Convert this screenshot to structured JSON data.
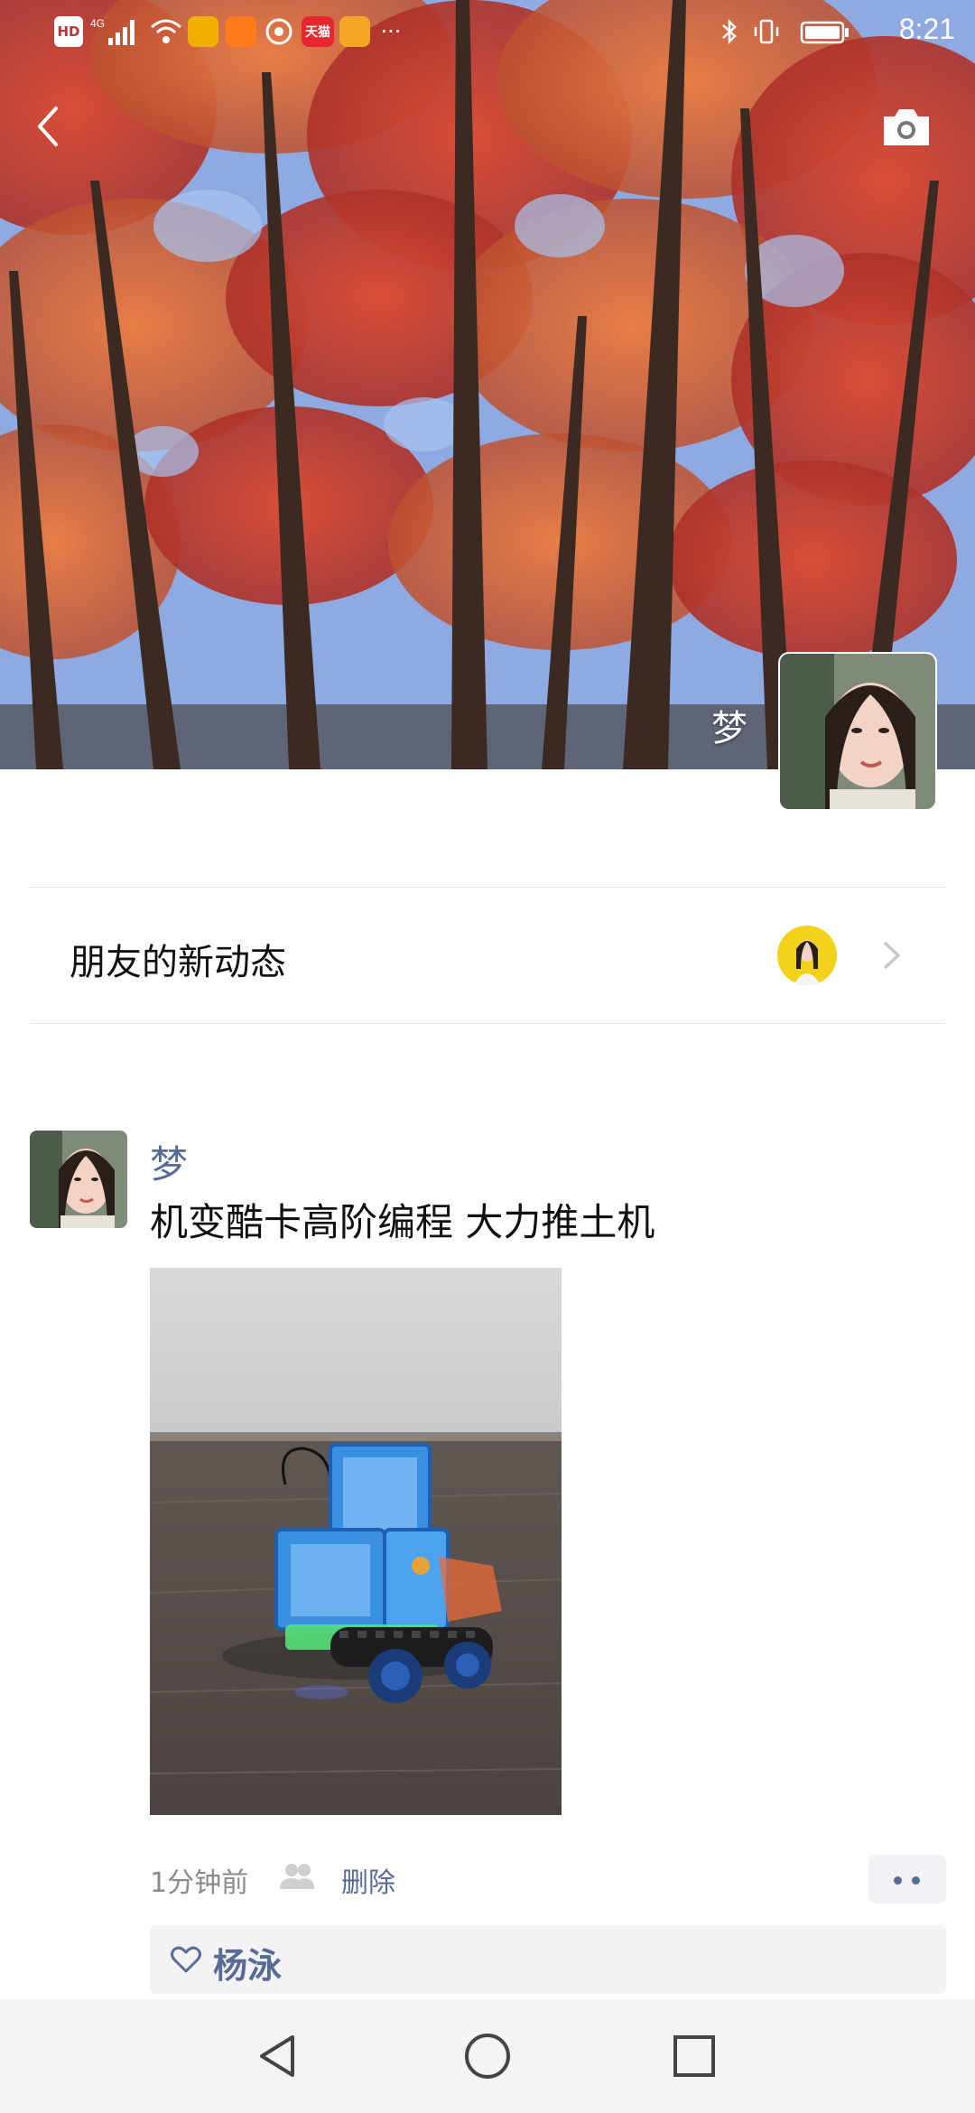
{
  "status_bar": {
    "signal_labels": [
      "HD",
      "4G"
    ],
    "app_badges": [
      {
        "icon": "yellow-app-icon",
        "color": "#f1b000"
      },
      {
        "icon": "orange-app-icon",
        "color": "#ff7a1a"
      },
      {
        "icon": "circle-app-icon",
        "color": "#ffffff"
      },
      {
        "icon": "tmall-icon",
        "label": "天猫",
        "color": "#e8262d"
      },
      {
        "icon": "dog-app-icon",
        "color": "#f5a623"
      }
    ],
    "more": "···",
    "time": "8:21"
  },
  "cover": {
    "name": "梦"
  },
  "friends_updates": {
    "label": "朋友的新动态"
  },
  "post": {
    "author": "梦",
    "text": "机变酷卡高阶编程 大力推土机",
    "time": "1分钟前",
    "delete_label": "删除",
    "likes": [
      "杨泳"
    ]
  },
  "colors": {
    "link": "#576b95",
    "meta": "#8a8a8a"
  }
}
